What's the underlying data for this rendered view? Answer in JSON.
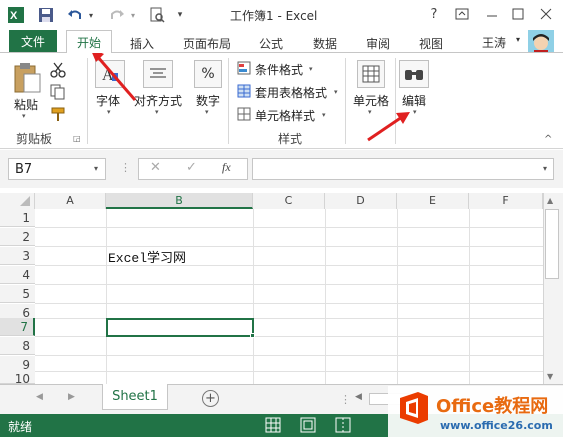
{
  "title_bar": {
    "title": "工作簿1 - Excel",
    "help": "?"
  },
  "qat": {
    "excel_logo": "X",
    "save_icon": "save-icon",
    "undo_icon": "undo-icon",
    "redo_icon": "redo-icon",
    "print_preview_icon": "print-preview-icon",
    "customize_icon": "▾"
  },
  "tabs": {
    "file": "文件",
    "home": "开始",
    "insert": "插入",
    "page_layout": "页面布局",
    "formulas": "公式",
    "data": "数据",
    "review": "审阅",
    "view": "视图",
    "user": "王涛"
  },
  "ribbon": {
    "clipboard": {
      "paste": "粘贴",
      "group": "剪贴板"
    },
    "font": "字体",
    "alignment": "对齐方式",
    "number": "数字",
    "styles": {
      "conditional": "条件格式",
      "table": "套用表格格式",
      "cell_styles": "单元格样式",
      "group": "样式"
    },
    "cells": "单元格",
    "editing": "编辑",
    "percent": "%"
  },
  "formula_bar": {
    "name_box": "B7",
    "fx": "fx",
    "formula": ""
  },
  "grid": {
    "columns": [
      "A",
      "B",
      "C",
      "D",
      "E",
      "F"
    ],
    "rows": [
      "1",
      "2",
      "3",
      "4",
      "5",
      "6",
      "7",
      "8",
      "9",
      "10"
    ],
    "cell_b3": "Excel学习网"
  },
  "sheets": {
    "active": "Sheet1",
    "add": "+"
  },
  "status": {
    "ready": "就绪"
  },
  "watermark": {
    "brand": "Office教程网",
    "url": "www.office26.com"
  },
  "colors": {
    "accent": "#217346",
    "arrow": "#e02020"
  }
}
